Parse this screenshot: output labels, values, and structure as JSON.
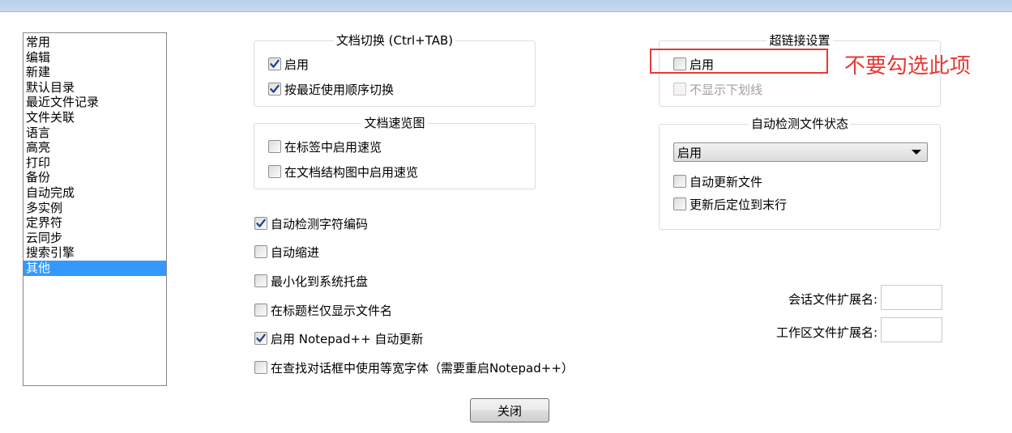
{
  "sidebar": {
    "items": [
      "常用",
      "编辑",
      "新建",
      "默认目录",
      "最近文件记录",
      "文件关联",
      "语言",
      "高亮",
      "打印",
      "备份",
      "自动完成",
      "多实例",
      "定界符",
      "云同步",
      "搜索引擎",
      "其他"
    ],
    "selected_index": 15
  },
  "doc_switch": {
    "title": "文档切换 (Ctrl+TAB)",
    "enable": {
      "label": "启用",
      "checked": true
    },
    "mru": {
      "label": "按最近使用顺序切换",
      "checked": true
    }
  },
  "doc_peek": {
    "title": "文档速览图",
    "in_tab": {
      "label": "在标签中启用速览",
      "checked": false
    },
    "in_map": {
      "label": "在文档结构图中启用速览",
      "checked": false
    }
  },
  "misc": {
    "detect_encoding": {
      "label": "自动检测字符编码",
      "checked": true
    },
    "auto_indent": {
      "label": "自动缩进",
      "checked": false
    },
    "minimize_tray": {
      "label": "最小化到系统托盘",
      "checked": false
    },
    "title_filename": {
      "label": "在标题栏仅显示文件名",
      "checked": false
    },
    "auto_update": {
      "label": "启用 Notepad++ 自动更新",
      "checked": true
    },
    "monospace_find": {
      "label": "在查找对话框中使用等宽字体（需要重启Notepad++）",
      "checked": false
    }
  },
  "hyperlink": {
    "title": "超链接设置",
    "enable": {
      "label": "启用",
      "checked": false
    },
    "no_underline": {
      "label": "不显示下划线",
      "checked": false,
      "disabled": true
    }
  },
  "file_status": {
    "title": "自动检测文件状态",
    "mode": "启用",
    "update_silently": {
      "label": "自动更新文件",
      "checked": false
    },
    "goto_end": {
      "label": "更新后定位到末行",
      "checked": false
    }
  },
  "session_ext": {
    "label": "会话文件扩展名:",
    "value": ""
  },
  "workspace_ext": {
    "label": "工作区文件扩展名:",
    "value": ""
  },
  "close_button": "关闭",
  "annotation": {
    "text": "不要勾选此项",
    "color": "#e53935"
  },
  "colors": {
    "selection": "#3399ff",
    "check": "#1f3f8f"
  }
}
